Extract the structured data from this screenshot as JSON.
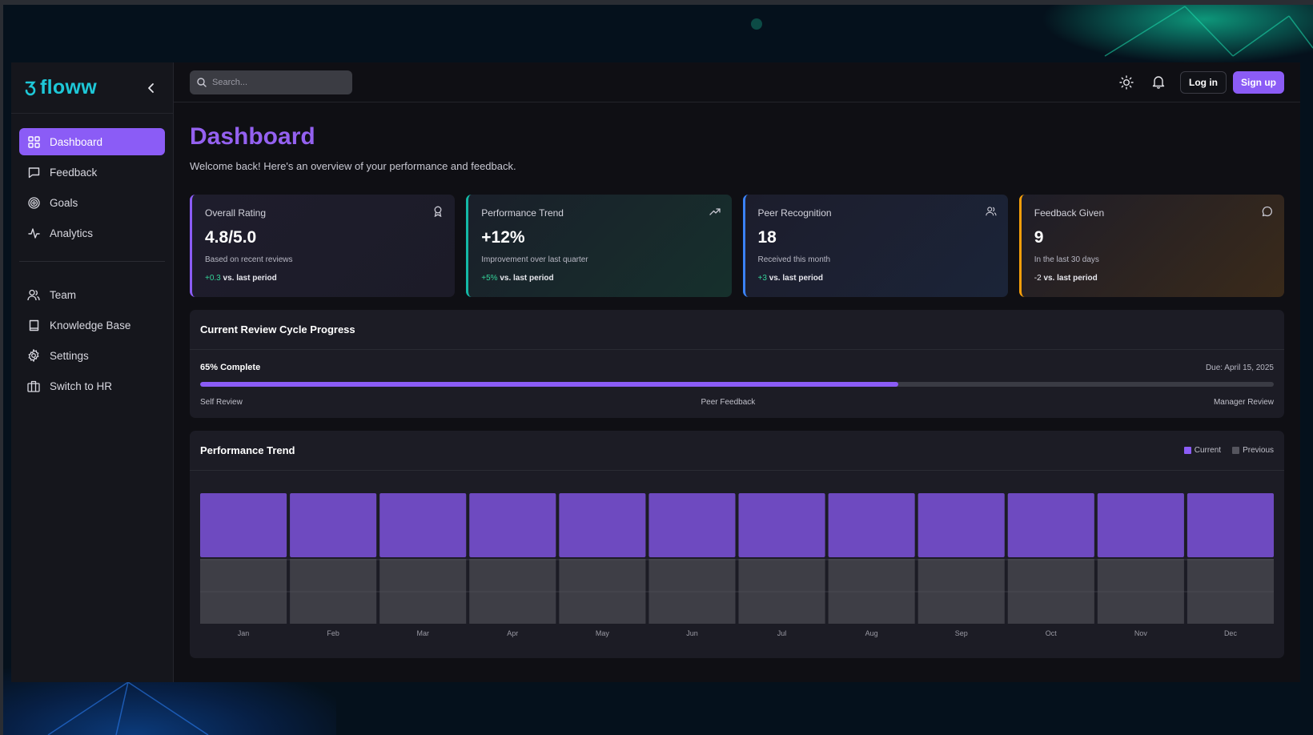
{
  "colors": {
    "accent": "#8b5cf6",
    "brand": "#1ec8d8",
    "current_bar": "#6e4ac0",
    "previous_bar": "#3e3e46"
  },
  "brand": {
    "name": "floww"
  },
  "search": {
    "placeholder": "Search..."
  },
  "sidebar": {
    "items": [
      {
        "label": "Dashboard",
        "icon": "grid-icon",
        "active": true
      },
      {
        "label": "Feedback",
        "icon": "message-square-icon"
      },
      {
        "label": "Goals",
        "icon": "target-icon"
      },
      {
        "label": "Analytics",
        "icon": "activity-icon"
      }
    ],
    "secondary": [
      {
        "label": "Team",
        "icon": "users-icon"
      },
      {
        "label": "Knowledge Base",
        "icon": "book-icon"
      },
      {
        "label": "Settings",
        "icon": "gear-icon"
      },
      {
        "label": "Switch to HR",
        "icon": "briefcase-icon"
      }
    ]
  },
  "topbar": {
    "login_label": "Log in",
    "signup_label": "Sign up",
    "theme_icon": "sun-icon",
    "notifications_icon": "bell-icon"
  },
  "page": {
    "title": "Dashboard",
    "subtitle": "Welcome back! Here's an overview of your performance and feedback."
  },
  "stats": [
    {
      "title": "Overall Rating",
      "value": "4.8/5.0",
      "description": "Based on recent reviews",
      "delta": "+0.3",
      "vs": "vs. last period",
      "icon": "award-icon"
    },
    {
      "title": "Performance Trend",
      "value": "+12%",
      "description": "Improvement over last quarter",
      "delta": "+5%",
      "vs": "vs. last period",
      "icon": "trending-up-icon"
    },
    {
      "title": "Peer Recognition",
      "value": "18",
      "description": "Received this month",
      "delta": "+3",
      "vs": "vs. last period",
      "icon": "users-icon"
    },
    {
      "title": "Feedback Given",
      "value": "9",
      "description": "In the last 30 days",
      "delta": "-2",
      "vs": "vs. last period",
      "icon": "message-circle-icon"
    }
  ],
  "review_cycle": {
    "title": "Current Review Cycle Progress",
    "progress_label": "65% Complete",
    "progress_percent": 65,
    "due": "Due: April 15, 2025",
    "steps": [
      "Self Review",
      "Peer Feedback",
      "Manager Review"
    ]
  },
  "performance": {
    "title": "Performance Trend",
    "legend": {
      "current": "Current",
      "previous": "Previous"
    }
  },
  "chart_data": {
    "type": "bar",
    "stacked": true,
    "categories": [
      "Jan",
      "Feb",
      "Mar",
      "Apr",
      "May",
      "Jun",
      "Jul",
      "Aug",
      "Sep",
      "Oct",
      "Nov",
      "Dec"
    ],
    "series": [
      {
        "name": "Previous",
        "values": [
          1,
          1,
          1,
          1,
          1,
          1,
          1,
          1,
          1,
          1,
          1,
          1
        ]
      },
      {
        "name": "Current",
        "values": [
          1,
          1,
          1,
          1,
          1,
          1,
          1,
          1,
          1,
          1,
          1,
          1
        ]
      }
    ],
    "ylim": [
      0,
      2
    ],
    "grid": true,
    "legend_position": "top-right"
  }
}
